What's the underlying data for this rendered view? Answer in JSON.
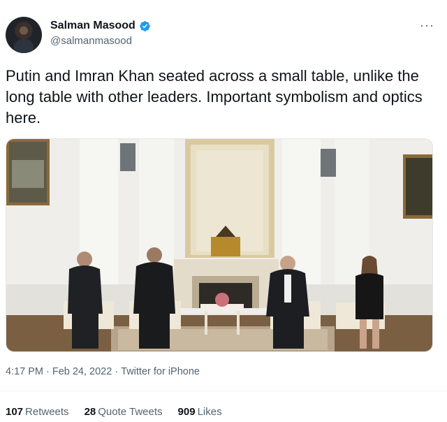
{
  "author": {
    "display_name": "Salman Masood",
    "handle": "@salmanmasood",
    "verified": true,
    "avatar_icon": "profile-avatar"
  },
  "menu_icon": "more-options-icon",
  "menu_glyph": "···",
  "tweet": {
    "text": "Putin and Imran Khan seated across a small table, unlike the long table with other leaders. Important symbolism and optics here."
  },
  "meta": {
    "time": "4:17 PM",
    "date": "Feb 24, 2022",
    "source": "Twitter for iPhone",
    "separator": "·"
  },
  "stats": {
    "retweets": {
      "count": "107",
      "label": "Retweets"
    },
    "quotes": {
      "count": "28",
      "label": "Quote Tweets"
    },
    "likes": {
      "count": "909",
      "label": "Likes"
    }
  },
  "colors": {
    "verified_blue": "#1d9bf0",
    "secondary_text": "#536471",
    "primary_text": "#0f1419"
  }
}
